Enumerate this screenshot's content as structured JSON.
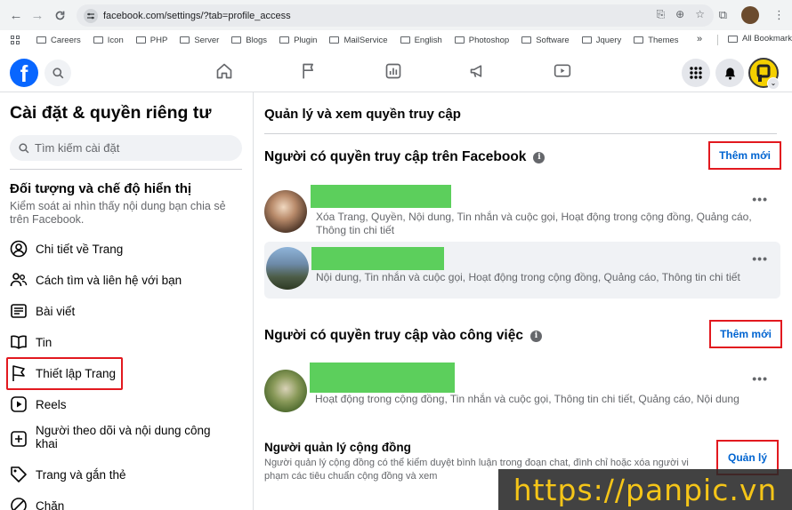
{
  "browser": {
    "url": "facebook.com/settings/?tab=profile_access",
    "bookmarks": [
      "Careers",
      "Icon",
      "PHP",
      "Server",
      "Blogs",
      "Plugin",
      "MailService",
      "English",
      "Photoshop",
      "Software",
      "Jquery",
      "Themes"
    ],
    "all_bookmarks": "All Bookmarks",
    "overflow": "»"
  },
  "sidebar": {
    "title": "Cài đặt & quyền riêng tư",
    "search_placeholder": "Tìm kiếm cài đặt",
    "section_title": "Đối tượng và chế độ hiển thị",
    "section_desc": "Kiểm soát ai nhìn thấy nội dung bạn chia sẻ trên Facebook.",
    "items": [
      {
        "label": "Chi tiết về Trang",
        "icon": "person-circle-icon"
      },
      {
        "label": "Cách tìm và liên hệ với bạn",
        "icon": "people-icon"
      },
      {
        "label": "Bài viết",
        "icon": "post-icon"
      },
      {
        "label": "Tin",
        "icon": "book-icon"
      },
      {
        "label": "Thiết lập Trang",
        "icon": "flag-icon"
      },
      {
        "label": "Reels",
        "icon": "reels-icon"
      },
      {
        "label": "Người theo dõi và nội dung công khai",
        "icon": "follow-icon"
      },
      {
        "label": "Trang và gắn thẻ",
        "icon": "tag-icon"
      },
      {
        "label": "Chặn",
        "icon": "block-icon"
      }
    ]
  },
  "main": {
    "title": "Quản lý và xem quyền truy cập",
    "fb_access": {
      "title": "Người có quyền truy cập trên Facebook",
      "add_label": "Thêm mới",
      "people": [
        {
          "perms": "Xóa Trang, Quyền, Nội dung, Tin nhắn và cuộc gọi, Hoạt động trong cộng đồng, Quảng cáo, Thông tin chi tiết"
        },
        {
          "perms": "Nội dung, Tin nhắn và cuộc gọi, Hoạt động trong cộng đồng, Quảng cáo, Thông tin chi tiết"
        }
      ]
    },
    "work_access": {
      "title": "Người có quyền truy cập vào công việc",
      "add_label": "Thêm mới",
      "people": [
        {
          "perms": "Hoạt động trong cộng đồng, Tin nhắn và cuộc gọi, Thông tin chi tiết, Quảng cáo, Nội dung"
        }
      ]
    },
    "community": {
      "title": "Người quản lý cộng đồng",
      "desc": "Người quản lý cộng đồng có thể kiểm duyệt bình luận trong đoạn chat, đình chỉ hoặc xóa người vi phạm các tiêu chuẩn cộng đồng và xem",
      "manage_label": "Quản lý"
    },
    "more_label": "•••"
  },
  "watermark": "https://panpic.vn",
  "colors": {
    "brand": "#0866ff",
    "highlight": "#e2191f",
    "link": "#0064d1",
    "name_redaction": "#5ccf5c"
  }
}
